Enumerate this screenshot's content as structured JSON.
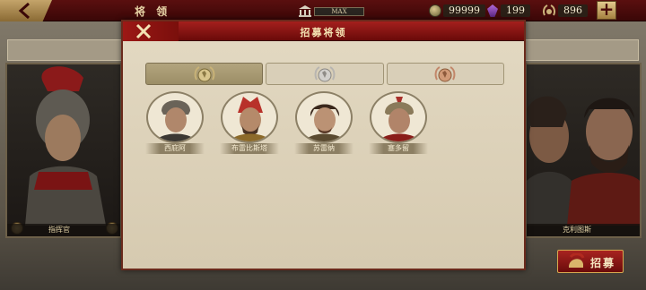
{
  "topbar": {
    "title": "将 领",
    "level_text": "MAX",
    "coins": "99999",
    "gems": "199",
    "laurels": "896",
    "plus_label": "+"
  },
  "background": {
    "left_card_name": "指挥官",
    "right_card_name": "克利图斯"
  },
  "recruit_button": {
    "label": "招募"
  },
  "modal": {
    "title": "招募将领",
    "tabs": [
      {
        "name": "gold",
        "active": true
      },
      {
        "name": "silver",
        "active": false
      },
      {
        "name": "bronze",
        "active": false
      }
    ],
    "generals": [
      {
        "name": "西庇阿"
      },
      {
        "name": "布雷比斯塔"
      },
      {
        "name": "苏雷纳"
      },
      {
        "name": "塞多留"
      }
    ]
  },
  "colors": {
    "header_red": "#a4201d",
    "panel_bg": "#d6cab0",
    "gold_accent": "#c4a46a"
  }
}
